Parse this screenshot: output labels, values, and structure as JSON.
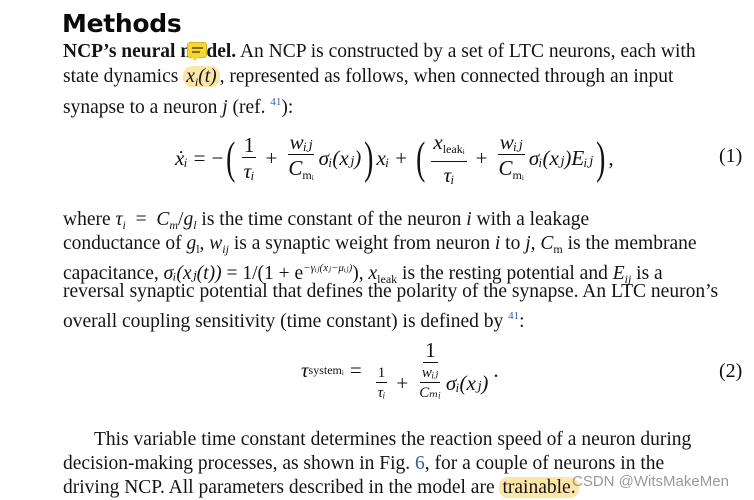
{
  "heading": "Methods",
  "para1": {
    "lead_bold": "NCP’s neural model.",
    "line1_rest": " An NCP is constructed by a set of LTC neurons, each with",
    "line2_pre": "state dynamics ",
    "line2_var": "x",
    "line2_sub": "i",
    "line2_arg": "(t)",
    "line2_rest": ", represented as follows, when connected through an input",
    "line3_pre": "synapse to a neuron ",
    "line3_j": "j",
    "line3_ref_open": " (ref. ",
    "line3_ref": "41",
    "line3_close": "):"
  },
  "equation1": {
    "lhs": "ẋᵢ",
    "equals": "=",
    "minus": "−",
    "term1_num": "1",
    "term1_den": "τᵢ",
    "plus": "+",
    "w_num": "wᵢⱼ",
    "c_den": "C",
    "c_sub": "mᵢ",
    "sigma": "σᵢ(xⱼ)",
    "xi": "xᵢ",
    "leak_num": "x",
    "leak_sub": "leakᵢ",
    "sigmaE": "σᵢ(xⱼ)Eᵢⱼ",
    "trail": ",",
    "number": "(1)"
  },
  "para2": {
    "l1a": "where ",
    "l1_tau": "τ",
    "l1_tau_sub": "i",
    "l1_eq": "  =  ",
    "l1_C": "C",
    "l1_C_sub": "m",
    "l1_slash": "/",
    "l1_g": "g",
    "l1_g_sub": "l",
    "l1_rest": " is the time constant of the neuron ",
    "l1_i": "i",
    "l1_end": " with a leakage",
    "l2a": "conductance of ",
    "l2_g": "g",
    "l2_g_sub": "l",
    "l2_comma": ", ",
    "l2_w": "w",
    "l2_w_sub": "ij",
    "l2_mid": " is a synaptic weight from neuron ",
    "l2_i": "i",
    "l2_to": " to ",
    "l2_j": "j",
    "l2_comma2": ", ",
    "l2_C": "C",
    "l2_C_sub": "m",
    "l2_end": " is the membrane",
    "l3a": "capacitance, ",
    "l3_sigma": "σᵢ(xⱼ(t))",
    "l3_eq": " = 1/(1 + e",
    "l3_exp": "−γᵢⱼ(xⱼ−μᵢⱼ)",
    "l3_close": "), ",
    "l3_x": "x",
    "l3_x_sub": "leak",
    "l3_mid": " is the resting potential and ",
    "l3_E": "E",
    "l3_E_sub": "ij",
    "l3_end": " is a",
    "l4": "reversal synaptic potential that defines the polarity of the synapse. An LTC neuron’s",
    "l5a": "overall coupling sensitivity (time constant) is defined by ",
    "l5_ref": "41",
    "l5_end": ":"
  },
  "equation2": {
    "lhs": "τ",
    "lhs_sub": "systemᵢ",
    "equals": "=",
    "num": "1",
    "den_1": "1",
    "den_tau": "τᵢ",
    "plus": "+",
    "den_w": "wᵢⱼ",
    "den_C": "Cₘᵢ",
    "den_sigma": "σᵢ(xⱼ)",
    "trail": ".",
    "number": "(2)"
  },
  "para3": {
    "l1": "This variable time constant determines the reaction speed of a neuron during",
    "l2a": "decision-making processes, as shown in Fig. ",
    "l2_fig": "6",
    "l2_end": ", for a couple of neurons in the",
    "l3a": "driving NCP. All parameters described in the model are ",
    "l3_hl": "trainable."
  },
  "annotations": {
    "highlight_color": "#fbe6a8",
    "comment_color": "#f5d63a",
    "link_color": "#3a5ba0"
  },
  "watermark": "CSDN @WitsMakeMen"
}
